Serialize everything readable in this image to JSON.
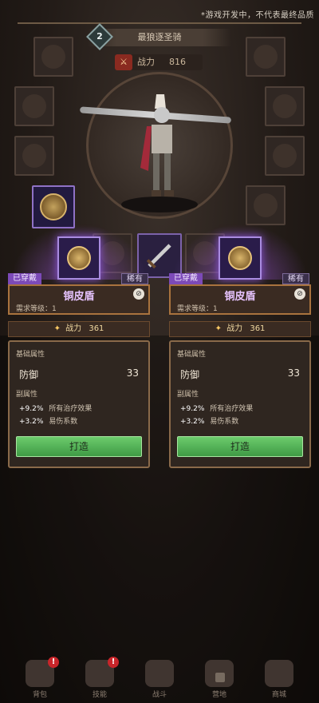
{
  "disclaimer": "*游戏开发中，不代表最终品质",
  "hero": {
    "level": "2",
    "name": "最狼逐圣骑",
    "power_label": "战力",
    "power_value": "816"
  },
  "cards": [
    {
      "status_tag": "已穿戴",
      "rarity_tag": "稀有",
      "item_name": "铜皮盾",
      "required_level": "需求等级：1",
      "combat_label": "战力",
      "combat_value": "361",
      "base_section": "基础属性",
      "base_stat_name": "防御",
      "base_stat_value": "33",
      "sub_section": "副属性",
      "sub_stats": [
        {
          "value": "+9.2%",
          "label": "所有治疗效果"
        },
        {
          "value": "+3.2%",
          "label": "易伤系数"
        }
      ],
      "forge_label": "打造"
    },
    {
      "status_tag": "已穿戴",
      "rarity_tag": "稀有",
      "item_name": "铜皮盾",
      "required_level": "需求等级：1",
      "combat_label": "战力",
      "combat_value": "361",
      "base_section": "基础属性",
      "base_stat_name": "防御",
      "base_stat_value": "33",
      "sub_section": "副属性",
      "sub_stats": [
        {
          "value": "+9.2%",
          "label": "所有治疗效果"
        },
        {
          "value": "+3.2%",
          "label": "易伤系数"
        }
      ],
      "forge_label": "打造"
    }
  ],
  "nav": [
    {
      "label": "背包",
      "icon": "backpack-icon",
      "badge": "!"
    },
    {
      "label": "技能",
      "icon": "skill-book-icon",
      "badge": "!"
    },
    {
      "label": "战斗",
      "icon": "battle-icon"
    },
    {
      "label": "营地",
      "icon": "camp-icon"
    },
    {
      "label": "商城",
      "icon": "shop-icon"
    }
  ],
  "colors": {
    "accent_purple": "#8a55d6",
    "forge_green": "#4caf50",
    "frame_brown": "#a9733e",
    "badge_red": "#c8252a"
  }
}
